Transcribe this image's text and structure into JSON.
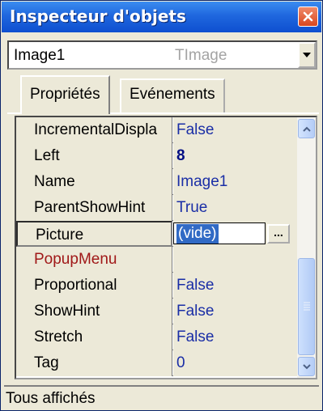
{
  "window": {
    "title": "Inspecteur d'objets"
  },
  "object_selector": {
    "name": "Image1",
    "type": "TImage"
  },
  "tabs": [
    {
      "label": "Propriétés",
      "active": true
    },
    {
      "label": "Evénements",
      "active": false
    }
  ],
  "properties": [
    {
      "name": "IncrementalDispla",
      "value": "False"
    },
    {
      "name": "Left",
      "value": "8"
    },
    {
      "name": "Name",
      "value": "Image1"
    },
    {
      "name": "ParentShowHint",
      "value": "True"
    },
    {
      "name": "Picture",
      "value": "(vide)"
    },
    {
      "name": "PopupMenu",
      "value": ""
    },
    {
      "name": "Proportional",
      "value": "False"
    },
    {
      "name": "ShowHint",
      "value": "False"
    },
    {
      "name": "Stretch",
      "value": "False"
    },
    {
      "name": "Tag",
      "value": "0"
    }
  ],
  "editor": {
    "ellipsis_label": "..."
  },
  "status": {
    "text": "Tous affichés"
  },
  "colors": {
    "title_bar": "#1f67de",
    "value_text": "#1a2ea6",
    "event_property": "#a01818",
    "selection": "#316ac5"
  },
  "icons": {
    "close": "close-icon",
    "dropdown": "chevron-down-icon",
    "scroll_up": "chevron-up-icon",
    "scroll_down": "chevron-down-icon"
  }
}
